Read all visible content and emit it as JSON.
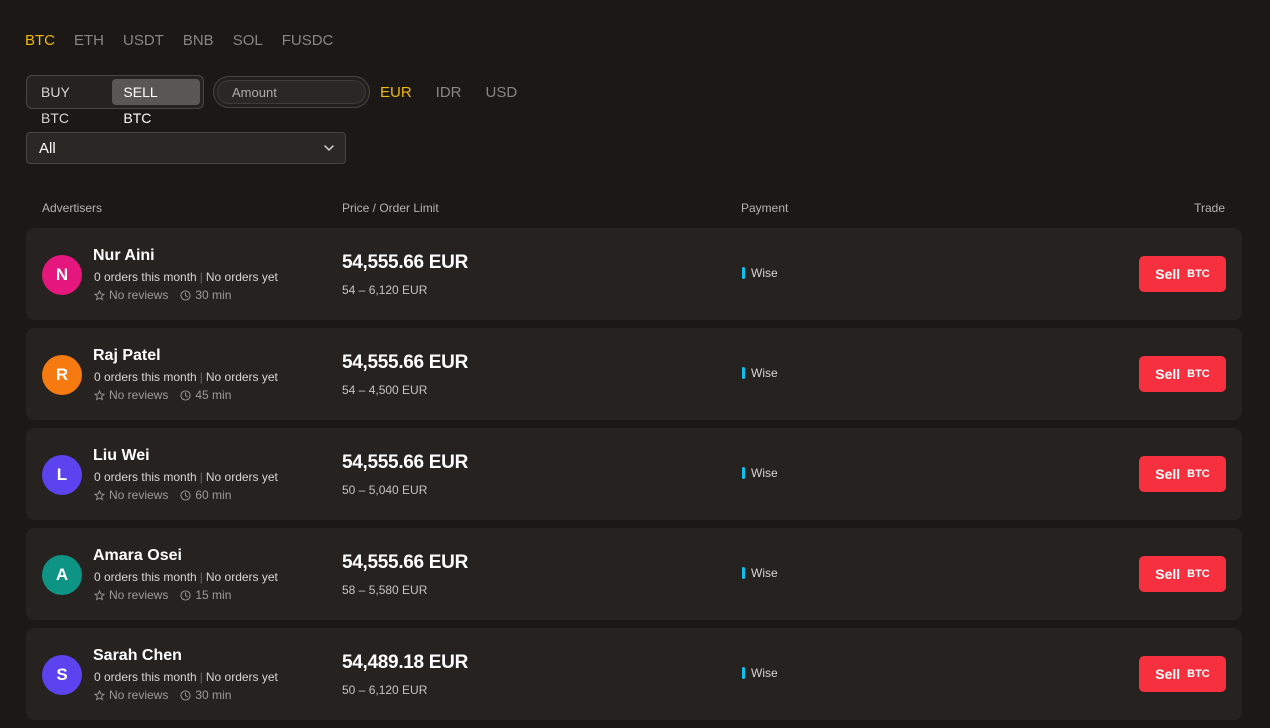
{
  "coin_tabs": [
    {
      "label": "BTC",
      "active": true
    },
    {
      "label": "ETH",
      "active": false
    },
    {
      "label": "USDT",
      "active": false
    },
    {
      "label": "BNB",
      "active": false
    },
    {
      "label": "SOL",
      "active": false
    },
    {
      "label": "FUSDC",
      "active": false
    }
  ],
  "side_toggle": {
    "buy_label": "BUY BTC",
    "sell_label": "SELL BTC",
    "selected": "sell"
  },
  "amount": {
    "placeholder": "Amount",
    "value": ""
  },
  "fiat_tabs": [
    {
      "label": "EUR",
      "active": true
    },
    {
      "label": "IDR",
      "active": false
    },
    {
      "label": "USD",
      "active": false
    }
  ],
  "payment_filter": {
    "selected": "All"
  },
  "table_headers": {
    "advertisers": "Advertisers",
    "price": "Price / Order Limit",
    "payment": "Payment",
    "trade": "Trade"
  },
  "rows": [
    {
      "initial": "N",
      "avatar_color": "#e5177e",
      "name": "Nur Aini",
      "orders": "0 orders this month",
      "completion": "No orders yet",
      "reviews": "No reviews",
      "time": "30 min",
      "price": "54,555.66 EUR",
      "limit": "54 – 6,120 EUR",
      "payment": "Wise",
      "action": "Sell",
      "action_coin": "BTC"
    },
    {
      "initial": "R",
      "avatar_color": "#f57a10",
      "name": "Raj Patel",
      "orders": "0 orders this month",
      "completion": "No orders yet",
      "reviews": "No reviews",
      "time": "45 min",
      "price": "54,555.66 EUR",
      "limit": "54 – 4,500 EUR",
      "payment": "Wise",
      "action": "Sell",
      "action_coin": "BTC"
    },
    {
      "initial": "L",
      "avatar_color": "#5b43f0",
      "name": "Liu Wei",
      "orders": "0 orders this month",
      "completion": "No orders yet",
      "reviews": "No reviews",
      "time": "60 min",
      "price": "54,555.66 EUR",
      "limit": "50 – 5,040 EUR",
      "payment": "Wise",
      "action": "Sell",
      "action_coin": "BTC"
    },
    {
      "initial": "A",
      "avatar_color": "#0d9484",
      "name": "Amara Osei",
      "orders": "0 orders this month",
      "completion": "No orders yet",
      "reviews": "No reviews",
      "time": "15 min",
      "price": "54,555.66 EUR",
      "limit": "58 – 5,580 EUR",
      "payment": "Wise",
      "action": "Sell",
      "action_coin": "BTC"
    },
    {
      "initial": "S",
      "avatar_color": "#5b43f0",
      "name": "Sarah Chen",
      "orders": "0 orders this month",
      "completion": "No orders yet",
      "reviews": "No reviews",
      "time": "30 min",
      "price": "54,489.18 EUR",
      "limit": "50 – 6,120 EUR",
      "payment": "Wise",
      "action": "Sell",
      "action_coin": "BTC"
    }
  ],
  "colors": {
    "accent": "#f0b90b",
    "sell": "#f6303f",
    "payment_bar": "#0ec2f0",
    "background": "#1c1816",
    "row_bg": "#262220"
  },
  "icons": {
    "review": "star-outline-icon",
    "time": "clock-icon",
    "dropdown": "chevron-down-icon"
  }
}
